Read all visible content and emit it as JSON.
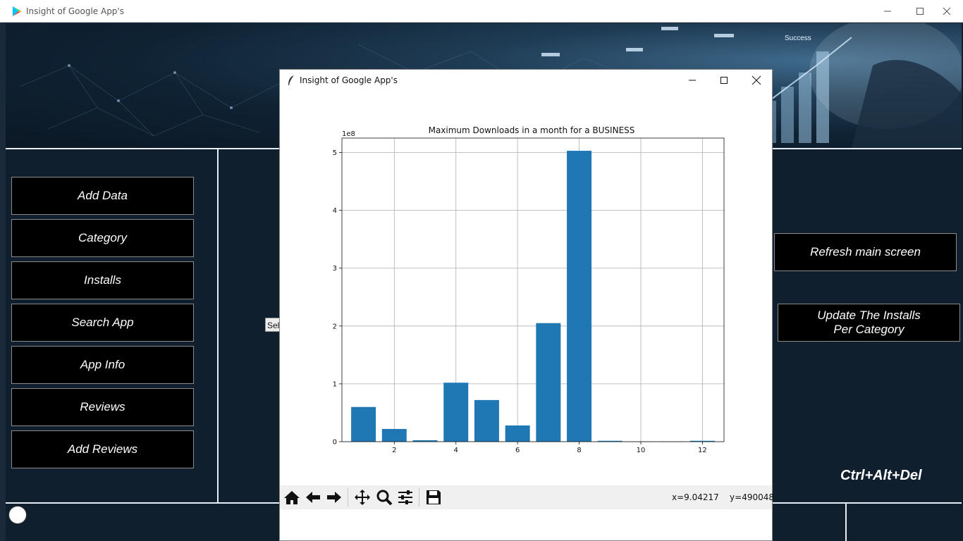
{
  "window": {
    "title": "Insight of Google App's"
  },
  "menu": {
    "items": [
      {
        "label": "Add Data"
      },
      {
        "label": "Category"
      },
      {
        "label": "Installs"
      },
      {
        "label": "Search App"
      },
      {
        "label": "App Info"
      },
      {
        "label": "Reviews"
      },
      {
        "label": "Add Reviews"
      }
    ]
  },
  "right_panel": {
    "refresh_label": "Refresh main screen",
    "update_line1": "Update The Installs",
    "update_line2": "Per Category",
    "shortcut_text": "Ctrl+Alt+Del"
  },
  "select_stub_text": "Sel",
  "popup": {
    "title": "Insight of Google App's",
    "coords_text": "x=9.04217    y=490048"
  },
  "chart_data": {
    "type": "bar",
    "title": "Maximum Downloads in a month for a BUSINESS",
    "xlabel": "",
    "ylabel": "",
    "y_offset_label": "1e8",
    "x": [
      1,
      2,
      3,
      4,
      5,
      6,
      7,
      8,
      9,
      10,
      11,
      12
    ],
    "values": [
      60000000,
      22000000,
      2500000,
      102000000,
      72000000,
      28000000,
      205000000,
      503000000,
      1500000,
      100000,
      100000,
      1500000
    ],
    "xlim": [
      0.3,
      12.7
    ],
    "ylim": [
      0,
      525000000
    ],
    "x_ticks": [
      2,
      4,
      6,
      8,
      10,
      12
    ],
    "y_ticks": [
      0,
      100000000,
      200000000,
      300000000,
      400000000,
      500000000
    ],
    "y_tick_labels": [
      "0",
      "1",
      "2",
      "3",
      "4",
      "5"
    ],
    "grid": true,
    "bar_color": "#1f77b4"
  },
  "colors": {
    "background": "#0f1f2d",
    "button_bg": "#000000",
    "bar": "#1f77b4"
  }
}
